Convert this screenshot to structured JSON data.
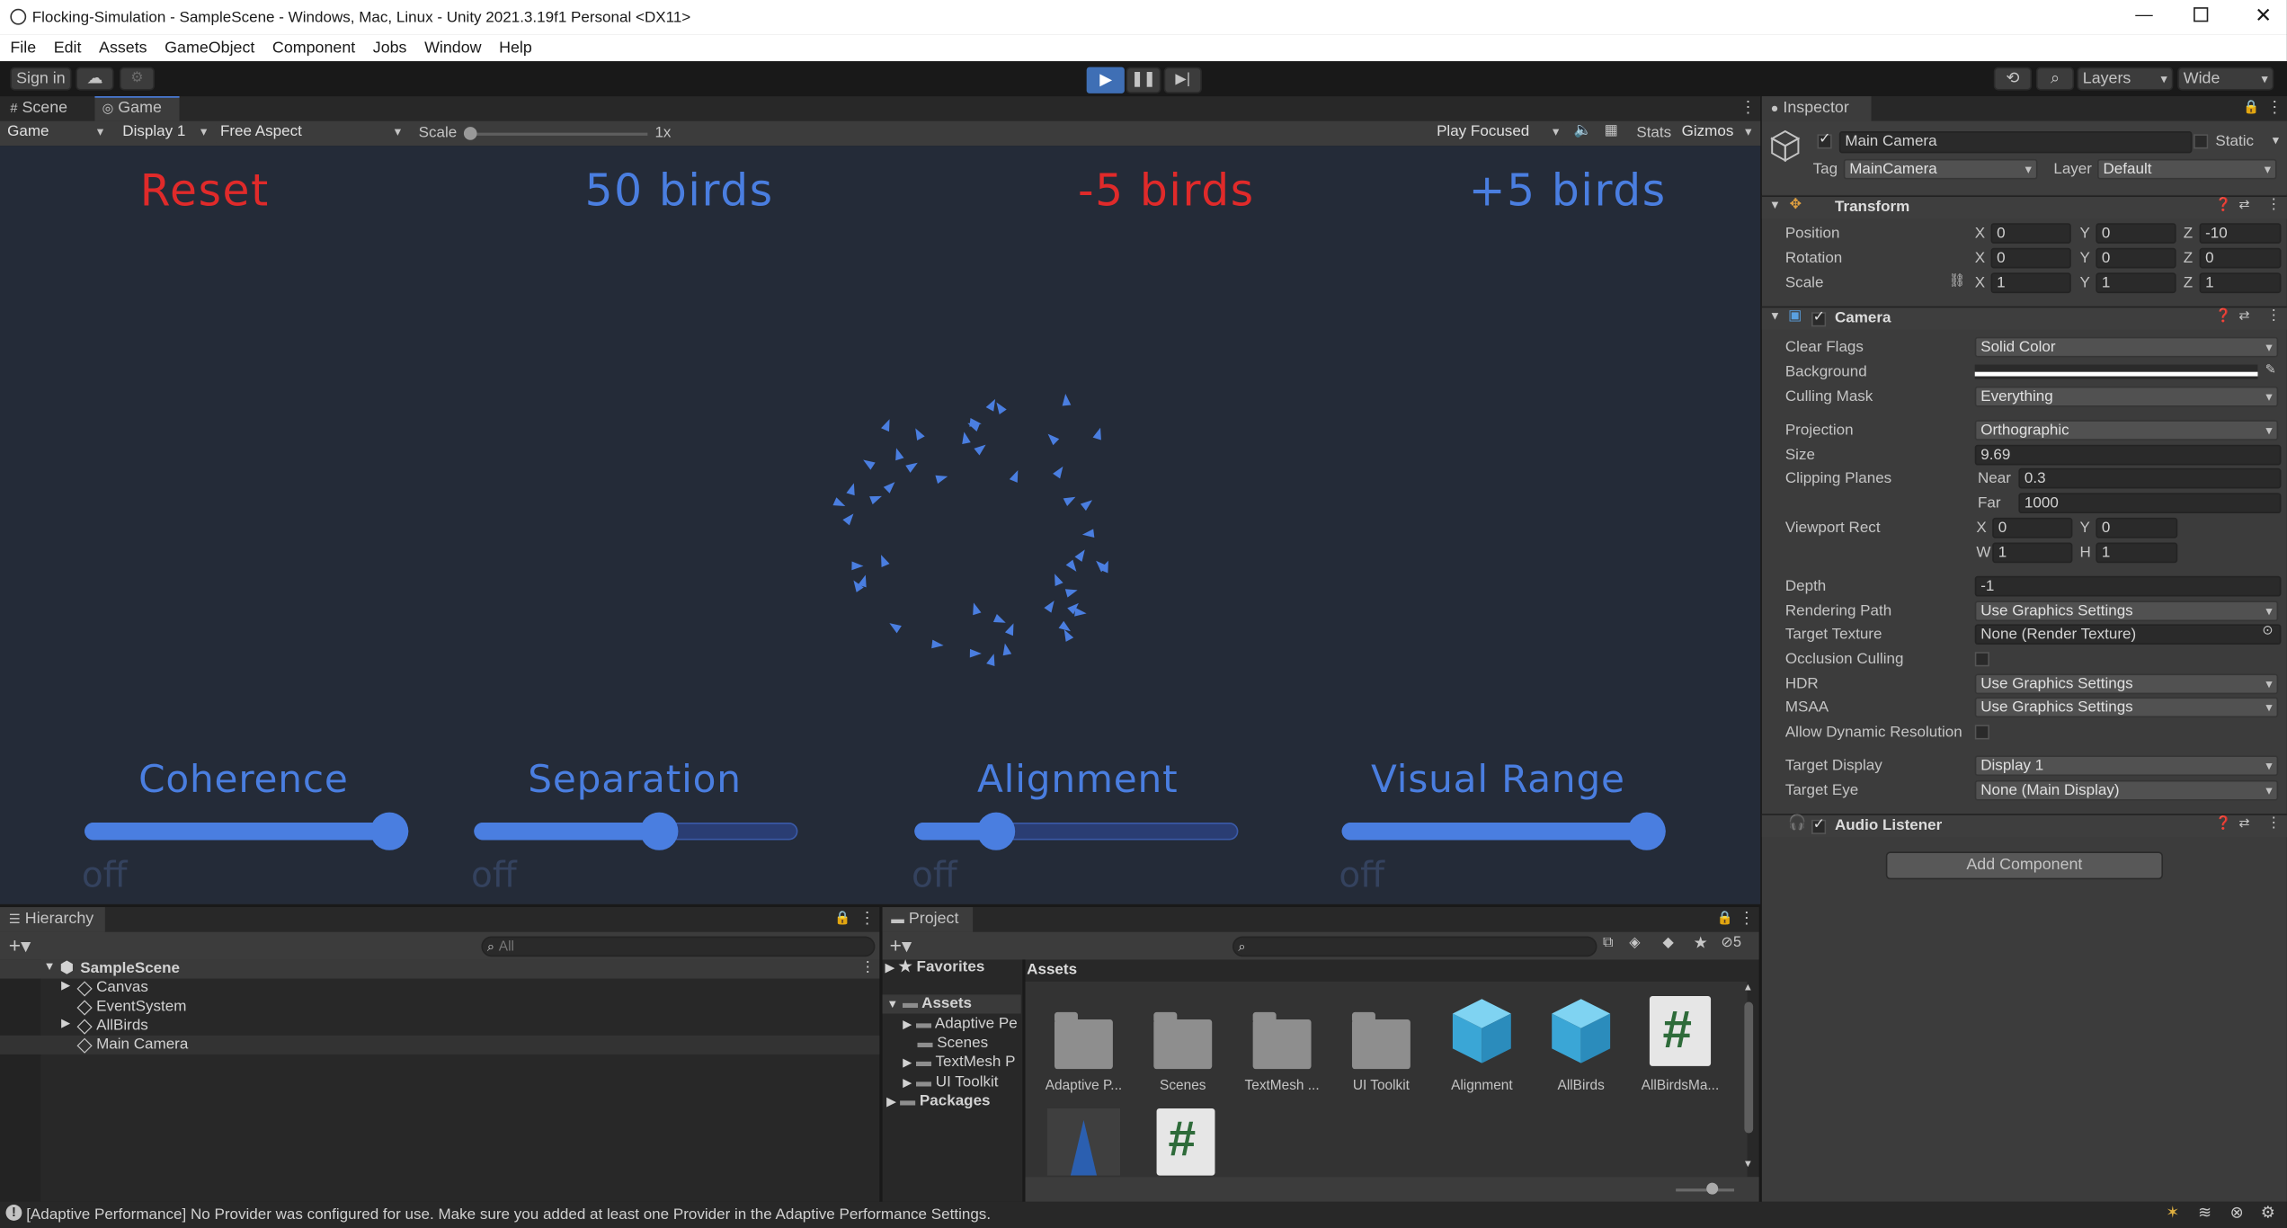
{
  "window": {
    "title": "Flocking-Simulation - SampleScene - Windows, Mac, Linux - Unity 2021.3.19f1 Personal <DX11>"
  },
  "menu": [
    "File",
    "Edit",
    "Assets",
    "GameObject",
    "Component",
    "Jobs",
    "Window",
    "Help"
  ],
  "toolbar": {
    "sign_in": "Sign in",
    "layers": "Layers",
    "layout": "Wide"
  },
  "tabs": {
    "scene": "Scene",
    "game": "Game"
  },
  "game_toolbar": {
    "view": "Game",
    "display": "Display 1",
    "aspect": "Free Aspect",
    "scale_label": "Scale",
    "scale_value": "1x",
    "play_mode": "Play Focused",
    "stats": "Stats",
    "gizmos": "Gizmos"
  },
  "game_view": {
    "buttons": {
      "reset": "Reset",
      "count": "50 birds",
      "minus": "-5 birds",
      "plus": "+5 birds"
    },
    "colors": {
      "red": "#e02a2a",
      "blue": "#4a7ee0",
      "bg": "#242b38"
    },
    "sliders": [
      {
        "label": "Coherence",
        "value": 1.0,
        "off": "off"
      },
      {
        "label": "Separation",
        "value": 0.58,
        "off": "off"
      },
      {
        "label": "Alignment",
        "value": 0.22,
        "off": "off"
      },
      {
        "label": "Visual Range",
        "value": 1.0,
        "off": "off"
      }
    ]
  },
  "hierarchy": {
    "title": "Hierarchy",
    "search_placeholder": "All",
    "scene": "SampleScene",
    "items": [
      "Canvas",
      "EventSystem",
      "AllBirds",
      "Main Camera"
    ]
  },
  "project": {
    "title": "Project",
    "favorites": "Favorites",
    "assets": "Assets",
    "packages": "Packages",
    "tree": [
      "Adaptive Pe",
      "Scenes",
      "TextMesh P",
      "UI Toolkit"
    ],
    "breadcrumb": "Assets",
    "hidden_count": "5",
    "grid": [
      {
        "label": "Adaptive P...",
        "icon": "folder-icon"
      },
      {
        "label": "Scenes",
        "icon": "folder-icon"
      },
      {
        "label": "TextMesh ...",
        "icon": "folder-icon"
      },
      {
        "label": "UI Toolkit",
        "icon": "folder-icon"
      },
      {
        "label": "Alignment",
        "icon": "prefab-icon"
      },
      {
        "label": "AllBirds",
        "icon": "prefab-icon"
      },
      {
        "label": "AllBirdsMa...",
        "icon": "script-icon"
      }
    ],
    "script_glyph": "#"
  },
  "inspector": {
    "title": "Inspector",
    "object_name": "Main Camera",
    "static_label": "Static",
    "tag_label": "Tag",
    "tag": "MainCamera",
    "layer_label": "Layer",
    "layer": "Default",
    "transform": {
      "title": "Transform",
      "position_label": "Position",
      "position": [
        "0",
        "0",
        "-10"
      ],
      "rotation_label": "Rotation",
      "rotation": [
        "0",
        "0",
        "0"
      ],
      "scale_label": "Scale",
      "scale": [
        "1",
        "1",
        "1"
      ],
      "axis": [
        "X",
        "Y",
        "Z"
      ]
    },
    "camera": {
      "title": "Camera",
      "clear_flags_label": "Clear Flags",
      "clear_flags": "Solid Color",
      "background_label": "Background",
      "culling_mask_label": "Culling Mask",
      "culling_mask": "Everything",
      "projection_label": "Projection",
      "projection": "Orthographic",
      "size_label": "Size",
      "size": "9.69",
      "clipping_label": "Clipping Planes",
      "near_label": "Near",
      "near": "0.3",
      "far_label": "Far",
      "far": "1000",
      "viewport_label": "Viewport Rect",
      "vx_label": "X",
      "vx": "0",
      "vy_label": "Y",
      "vy": "0",
      "vw_label": "W",
      "vw": "1",
      "vh_label": "H",
      "vh": "1",
      "depth_label": "Depth",
      "depth": "-1",
      "rendering_path_label": "Rendering Path",
      "rendering_path": "Use Graphics Settings",
      "target_texture_label": "Target Texture",
      "target_texture": "None (Render Texture)",
      "occlusion_label": "Occlusion Culling",
      "hdr_label": "HDR",
      "hdr": "Use Graphics Settings",
      "msaa_label": "MSAA",
      "msaa": "Use Graphics Settings",
      "dynamic_res_label": "Allow Dynamic Resolution",
      "target_display_label": "Target Display",
      "target_display": "Display 1",
      "target_eye_label": "Target Eye",
      "target_eye": "None (Main Display)"
    },
    "audio_listener": "Audio Listener",
    "add_component": "Add Component"
  },
  "status_bar": "[Adaptive Performance] No Provider was configured for use. Make sure you added at least one Provider in the Adaptive Performance Settings."
}
